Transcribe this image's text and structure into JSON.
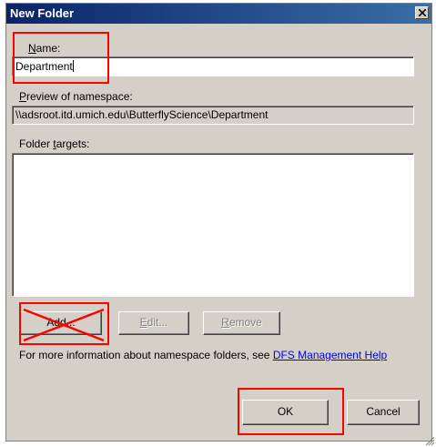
{
  "window": {
    "title": "New Folder"
  },
  "name": {
    "label_hotkey": "N",
    "label_rest": "ame:",
    "value": "Department"
  },
  "preview": {
    "label_hotkey": "P",
    "label_rest": "review of namespace:",
    "value": "\\\\adsroot.itd.umich.edu\\ButterflyScience\\Department"
  },
  "targets": {
    "label_pre": "Folder ",
    "label_hotkey": "t",
    "label_rest": "argets:",
    "items": []
  },
  "buttons": {
    "add_label": "Add...",
    "edit_hotkey": "E",
    "edit_rest": "dit...",
    "remove_hotkey": "R",
    "remove_rest": "emove",
    "ok_label": "OK",
    "cancel_label": "Cancel"
  },
  "info": {
    "text": "For more information about namespace folders, see ",
    "link_text": "DFS Management Help"
  },
  "annotations": {
    "color": "#ff0000"
  }
}
